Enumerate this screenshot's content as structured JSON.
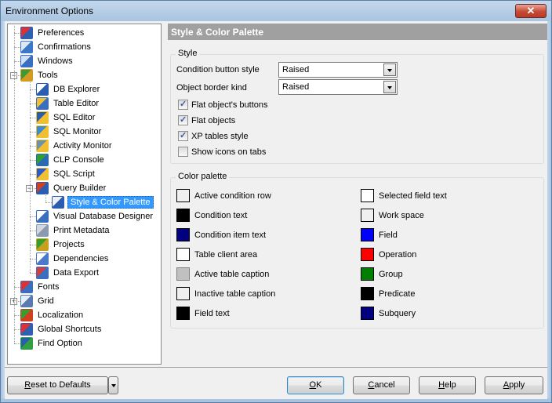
{
  "window": {
    "title": "Environment Options",
    "close_label": "✕"
  },
  "tree": {
    "items": [
      {
        "label": "Preferences",
        "icon": "preferences-icon",
        "level": 0
      },
      {
        "label": "Confirmations",
        "icon": "confirmations-icon",
        "level": 0
      },
      {
        "label": "Windows",
        "icon": "windows-icon",
        "level": 0
      },
      {
        "label": "Tools",
        "icon": "tools-icon",
        "level": 0,
        "expanded": true
      },
      {
        "label": "DB Explorer",
        "icon": "db-explorer-icon",
        "level": 1
      },
      {
        "label": "Table Editor",
        "icon": "table-editor-icon",
        "level": 1
      },
      {
        "label": "SQL Editor",
        "icon": "sql-editor-icon",
        "level": 1
      },
      {
        "label": "SQL Monitor",
        "icon": "sql-monitor-icon",
        "level": 1
      },
      {
        "label": "Activity Monitor",
        "icon": "activity-monitor-icon",
        "level": 1
      },
      {
        "label": "CLP Console",
        "icon": "clp-console-icon",
        "level": 1
      },
      {
        "label": "SQL Script",
        "icon": "sql-script-icon",
        "level": 1
      },
      {
        "label": "Query Builder",
        "icon": "query-builder-icon",
        "level": 1,
        "expanded": true
      },
      {
        "label": "Style & Color Palette",
        "icon": "palette-icon",
        "level": 2,
        "selected": true
      },
      {
        "label": "Visual Database Designer",
        "icon": "vdd-icon",
        "level": 1
      },
      {
        "label": "Print Metadata",
        "icon": "printer-icon",
        "level": 1
      },
      {
        "label": "Projects",
        "icon": "projects-icon",
        "level": 1
      },
      {
        "label": "Dependencies",
        "icon": "dependencies-icon",
        "level": 1
      },
      {
        "label": "Data Export",
        "icon": "data-export-icon",
        "level": 1
      },
      {
        "label": "Fonts",
        "icon": "fonts-icon",
        "level": 0
      },
      {
        "label": "Grid",
        "icon": "grid-icon",
        "level": 0,
        "collapsed": true
      },
      {
        "label": "Localization",
        "icon": "localization-icon",
        "level": 0
      },
      {
        "label": "Global Shortcuts",
        "icon": "shortcuts-icon",
        "level": 0
      },
      {
        "label": "Find Option",
        "icon": "find-option-icon",
        "level": 0
      }
    ]
  },
  "panel": {
    "title": "Style & Color Palette",
    "style_group": {
      "title": "Style",
      "condition_button_style_label": "Condition button style",
      "condition_button_style_value": "Raised",
      "object_border_kind_label": "Object border kind",
      "object_border_kind_value": "Raised",
      "checkboxes": [
        {
          "label": "Flat object's buttons",
          "checked": true
        },
        {
          "label": "Flat objects",
          "checked": true
        },
        {
          "label": "XP tables style",
          "checked": true
        },
        {
          "label": "Show icons on tabs",
          "checked": false
        }
      ]
    },
    "color_group": {
      "title": "Color palette",
      "left": [
        {
          "label": "Active condition row",
          "color": "#f0f0f0"
        },
        {
          "label": "Condition text",
          "color": "#000000"
        },
        {
          "label": "Condition item text",
          "color": "#000080"
        },
        {
          "label": "Table client area",
          "color": "#ffffff"
        },
        {
          "label": "Active table caption",
          "color": "#c0c0c0"
        },
        {
          "label": "Inactive table caption",
          "color": "#f0f0f0"
        },
        {
          "label": "Field text",
          "color": "#000000"
        }
      ],
      "right": [
        {
          "label": "Selected field text",
          "color": "#ffffff"
        },
        {
          "label": "Work space",
          "color": "#f0f0f0"
        },
        {
          "label": "Field",
          "color": "#0000ff"
        },
        {
          "label": "Operation",
          "color": "#ff0000"
        },
        {
          "label": "Group",
          "color": "#008000"
        },
        {
          "label": "Predicate",
          "color": "#000000"
        },
        {
          "label": "Subquery",
          "color": "#000080"
        }
      ]
    }
  },
  "buttons": {
    "reset_first": "R",
    "reset_rest": "eset to Defaults",
    "ok_first": "O",
    "ok_rest": "K",
    "cancel_first": "C",
    "cancel_rest": "ancel",
    "help_first": "H",
    "help_rest": "elp",
    "apply_first": "A",
    "apply_rest": "pply"
  }
}
